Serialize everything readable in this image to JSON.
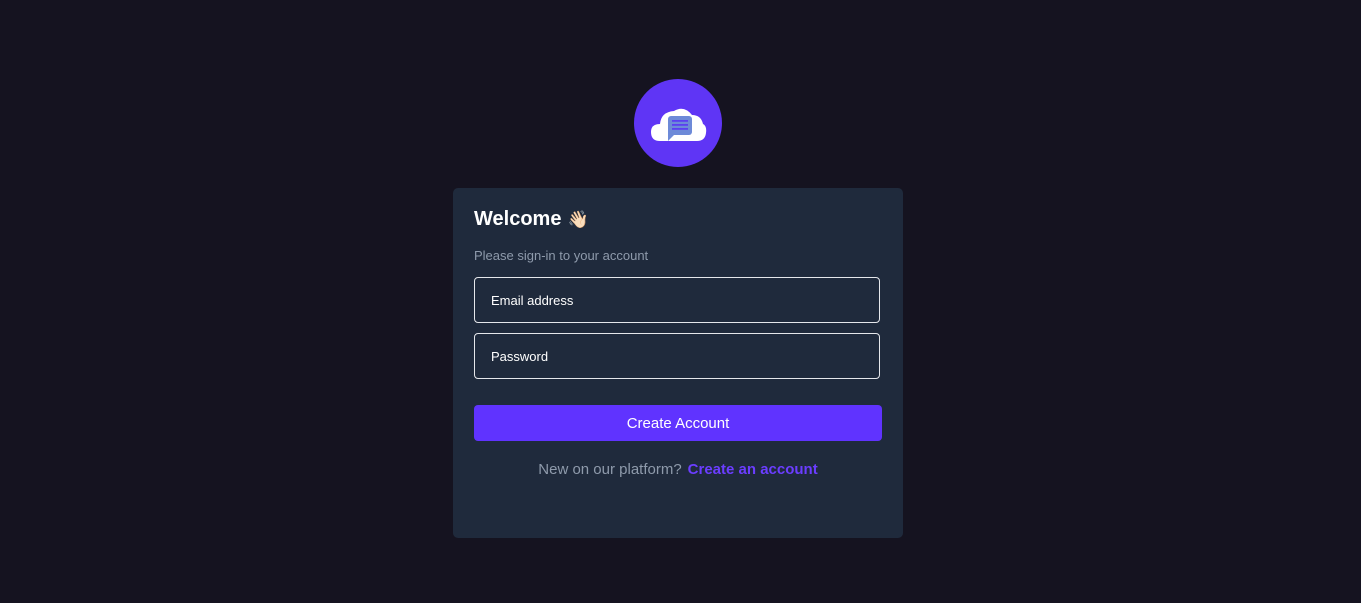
{
  "title": "Welcome",
  "wave_emoji": "👋🏻",
  "subtitle": "Please sign-in to your account",
  "email": {
    "placeholder": "Email address",
    "value": ""
  },
  "password": {
    "placeholder": "Password",
    "value": ""
  },
  "submit_label": "Create Account",
  "footer": {
    "text": "New on our platform?",
    "link": "Create an account"
  },
  "colors": {
    "accent": "#6033ff",
    "card": "#1f2a3c",
    "background": "#151320"
  }
}
